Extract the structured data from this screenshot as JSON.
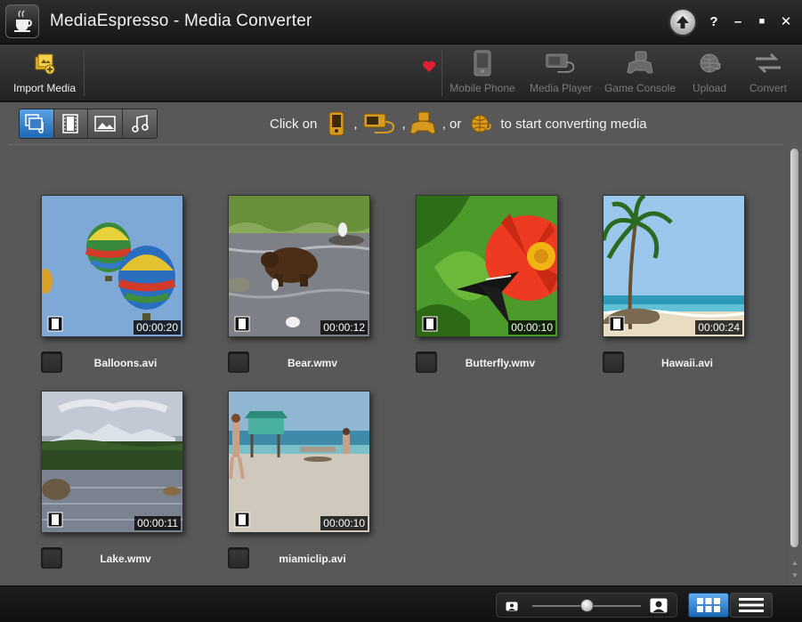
{
  "window": {
    "title": "MediaEspresso - Media Converter",
    "controls": {
      "help": "?",
      "minimize": "–",
      "maximize": "■",
      "close": "✕"
    }
  },
  "toolbar": {
    "import_label": "Import Media",
    "mobile_label": "Mobile Phone",
    "player_label": "Media Player",
    "console_label": "Game Console",
    "upload_label": "Upload",
    "convert_label": "Convert"
  },
  "filters": [
    "all-media-icon",
    "video-filter-icon",
    "photo-filter-icon",
    "music-filter-icon"
  ],
  "hint": {
    "prefix": "Click on",
    "comma": ",",
    "or": ", or",
    "suffix": "to start converting media"
  },
  "media": [
    {
      "name": "Balloons.avi",
      "duration": "00:00:20"
    },
    {
      "name": "Bear.wmv",
      "duration": "00:00:12"
    },
    {
      "name": "Butterfly.wmv",
      "duration": "00:00:10"
    },
    {
      "name": "Hawaii.avi",
      "duration": "00:00:24"
    },
    {
      "name": "Lake.wmv",
      "duration": "00:00:11"
    },
    {
      "name": "miamiclip.avi",
      "duration": "00:00:10"
    }
  ],
  "status": {
    "zoom_level": 0.5,
    "active_view": "grid"
  },
  "colors": {
    "accent": "#2b7fd3",
    "background": "#585858",
    "titlebar": "#1e1e1e"
  }
}
